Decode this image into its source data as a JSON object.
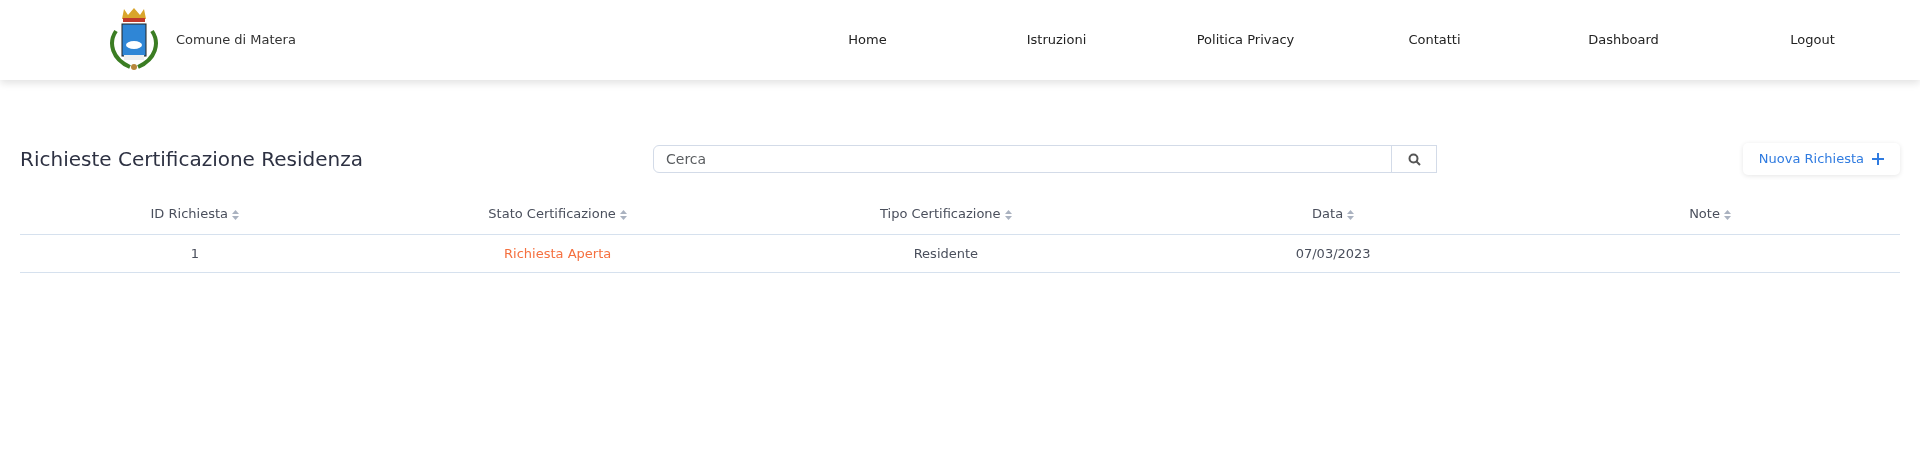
{
  "navbar": {
    "brand": "Comune di Matera",
    "links": [
      {
        "label": "Home"
      },
      {
        "label": "Istruzioni"
      },
      {
        "label": "Politica Privacy"
      },
      {
        "label": "Contatti"
      },
      {
        "label": "Dashboard"
      },
      {
        "label": "Logout"
      }
    ]
  },
  "page_title": "Richieste Certificazione Residenza",
  "search": {
    "placeholder": "Cerca"
  },
  "new_button": {
    "label": "Nuova Richiesta"
  },
  "table": {
    "columns": [
      "ID Richiesta",
      "Stato Certificazione",
      "Tipo Certificazione",
      "Data",
      "Note"
    ],
    "rows": [
      {
        "id": "1",
        "status": {
          "text": "Richiesta Aperta",
          "color": "#f5703f"
        },
        "type": "Residente",
        "date": "07/03/2023"
      }
    ]
  }
}
